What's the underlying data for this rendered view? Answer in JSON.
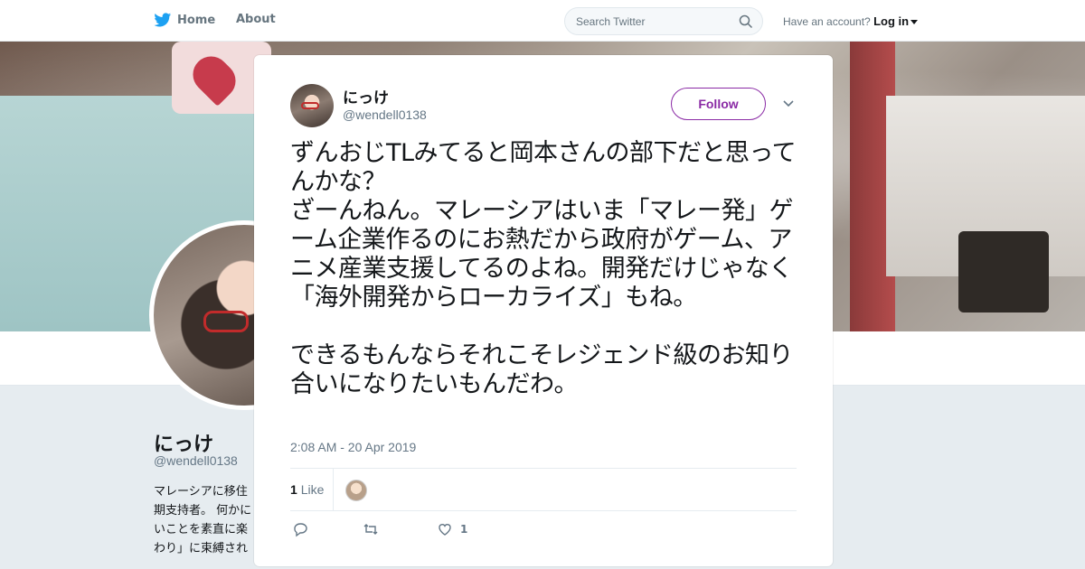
{
  "nav": {
    "home_label": "Home",
    "about_label": "About",
    "search_placeholder": "Search Twitter",
    "account_prompt": "Have an account?",
    "login_label": "Log in"
  },
  "profile": {
    "name": "にっけ",
    "handle": "@wendell0138",
    "bio_visible": "マレーシアに移住\n期支持者。 何かに\nいことを素直に楽\nわり」に束縛され"
  },
  "tweet": {
    "author_name": "にっけ",
    "author_handle": "@wendell0138",
    "follow_label": "Follow",
    "text": "ずんおじTLみてると岡本さんの部下だと思ってんかな？\nざーんねん。マレーシアはいま「マレー発」ゲーム企業作るのにお熱だから政府がゲーム、アニメ産業支援してるのよね。開発だけじゃなく「海外開発からローカライズ」もね。\n\nできるもんならそれこそレジェンド級のお知り合いになりたいもんだわ。",
    "timestamp": "2:08 AM - 20 Apr 2019",
    "like_count": "1",
    "like_label": "Like",
    "action_like_count": "1"
  },
  "colors": {
    "accent": "#8a2aa5",
    "twitter_blue": "#1da1f2",
    "muted_text": "#657786"
  },
  "icons": [
    "twitter-bird-icon",
    "search-icon",
    "close-icon",
    "chevron-down-icon",
    "reply-icon",
    "retweet-icon",
    "heart-icon"
  ]
}
